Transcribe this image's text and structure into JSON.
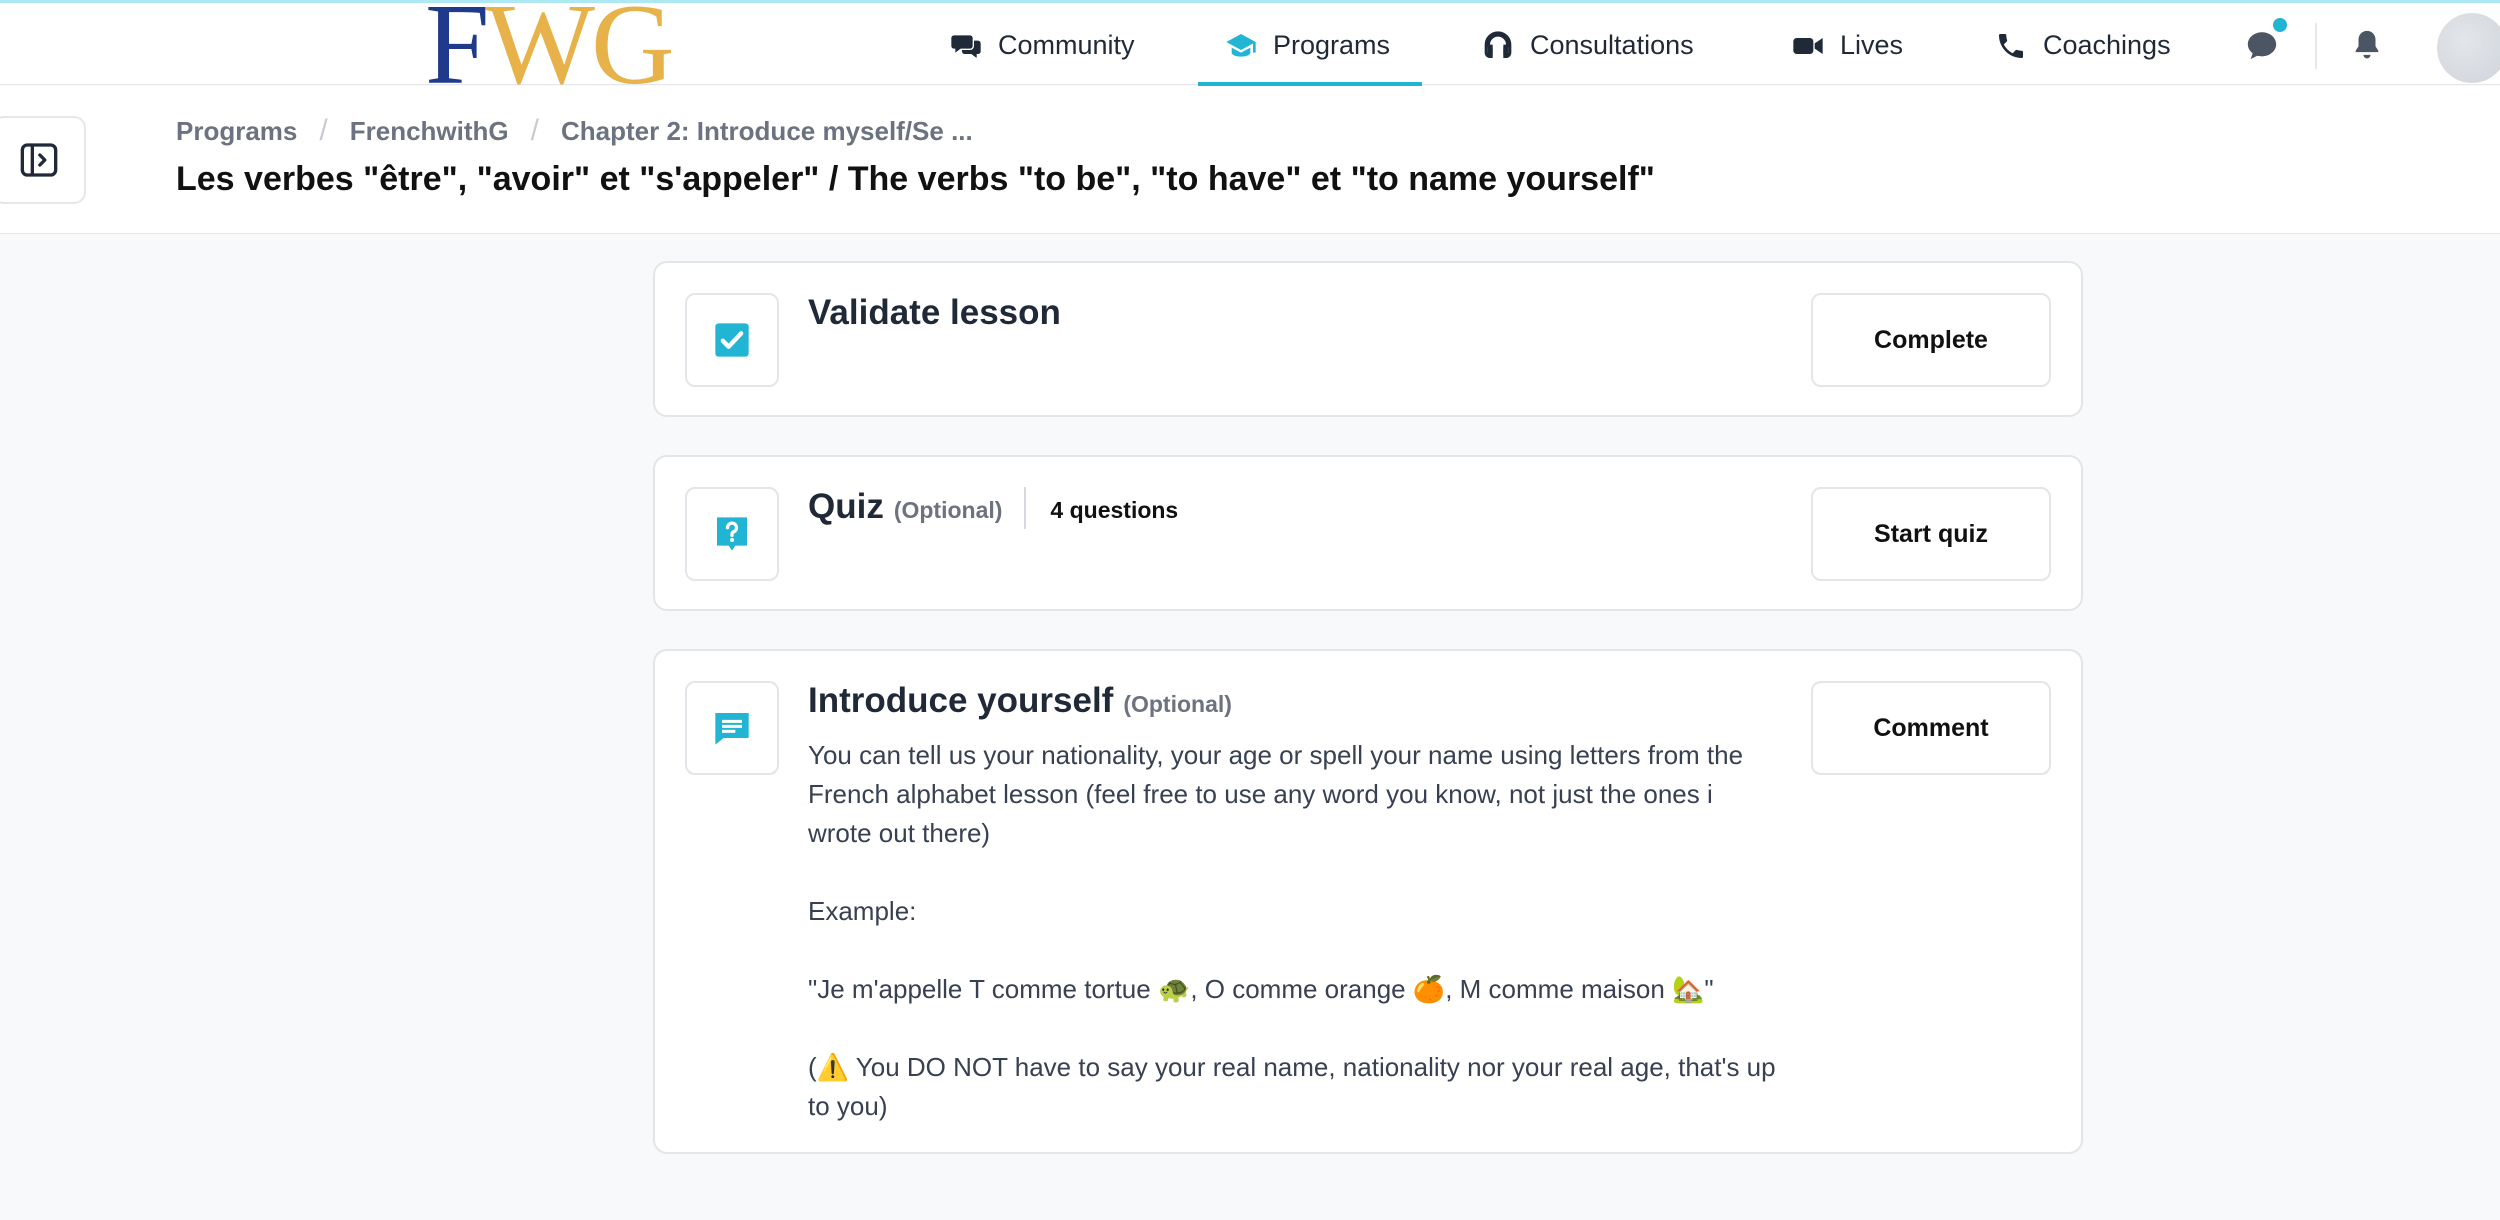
{
  "nav": {
    "logo": {
      "f": "F",
      "w": "W",
      "g": "G"
    },
    "items": [
      {
        "label": "Community",
        "icon": "chat-bubbles-icon"
      },
      {
        "label": "Programs",
        "icon": "graduation-cap-icon",
        "active": true
      },
      {
        "label": "Consultations",
        "icon": "headset-icon"
      },
      {
        "label": "Lives",
        "icon": "video-camera-icon"
      },
      {
        "label": "Coachings",
        "icon": "phone-icon"
      }
    ],
    "accent_color": "#22b5d3"
  },
  "header": {
    "breadcrumb": [
      "Programs",
      "FrenchwithG",
      "Chapter 2: Introduce myself/Se ..."
    ],
    "title": "Les verbes \"être\", \"avoir\" et \"s'appeler\" / The verbs \"to be\", \"to have\" et \"to name yourself\""
  },
  "cards": {
    "validate": {
      "title": "Validate lesson",
      "button": "Complete",
      "icon": "checkbox-checked-icon"
    },
    "quiz": {
      "title": "Quiz",
      "optional": "(Optional)",
      "meta": "4 questions",
      "button": "Start quiz",
      "icon": "question-bubble-icon"
    },
    "introduce": {
      "title": "Introduce yourself",
      "optional": "(Optional)",
      "button": "Comment",
      "icon": "message-icon",
      "body": {
        "p1": "You can tell us your nationality, your age or spell your name using letters from the French alphabet lesson (feel free to use any word you know, not just the ones i wrote out there)",
        "p2": "Example:",
        "p3": "\"Je m'appelle T comme tortue 🐢, O comme orange 🍊, M comme maison 🏡\"",
        "p4": "(⚠️ You DO NOT have to say your real name, nationality nor your real age, that's up to you)"
      }
    }
  }
}
